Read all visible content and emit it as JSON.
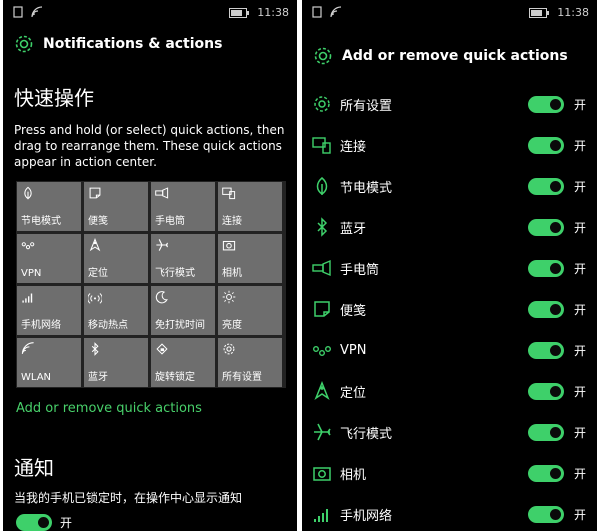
{
  "left_screen": {
    "status": {
      "time": "11:38"
    },
    "title": "Notifications & actions",
    "section_title": "快速操作",
    "description": "Press and hold (or select) quick actions, then drag to rearrange them. These quick actions appear in action center.",
    "tiles": [
      {
        "label": "节电模式",
        "icon": "leaf-icon"
      },
      {
        "label": "便笺",
        "icon": "note-icon"
      },
      {
        "label": "手电筒",
        "icon": "flashlight-icon"
      },
      {
        "label": "连接",
        "icon": "connect-icon"
      },
      {
        "label": "VPN",
        "icon": "vpn-icon"
      },
      {
        "label": "定位",
        "icon": "location-icon"
      },
      {
        "label": "飞行模式",
        "icon": "airplane-icon"
      },
      {
        "label": "相机",
        "icon": "camera-icon"
      },
      {
        "label": "手机网络",
        "icon": "signal-icon"
      },
      {
        "label": "移动热点",
        "icon": "hotspot-icon"
      },
      {
        "label": "免打扰时间",
        "icon": "moon-icon"
      },
      {
        "label": "亮度",
        "icon": "brightness-icon"
      },
      {
        "label": "WLAN",
        "icon": "wifi-icon"
      },
      {
        "label": "蓝牙",
        "icon": "bluetooth-icon"
      },
      {
        "label": "旋转锁定",
        "icon": "rotation-lock-icon"
      },
      {
        "label": "所有设置",
        "icon": "gear-icon"
      }
    ],
    "add_remove_link": "Add or remove quick actions",
    "notify_title": "通知",
    "notify_text": "当我的手机已锁定时，在操作中心显示通知",
    "notify_toggle_state": "开"
  },
  "right_screen": {
    "status": {
      "time": "11:38"
    },
    "title": "Add or remove quick actions",
    "items": [
      {
        "label": "所有设置",
        "icon": "gear-icon",
        "state": "开"
      },
      {
        "label": "连接",
        "icon": "connect-icon",
        "state": "开"
      },
      {
        "label": "节电模式",
        "icon": "leaf-icon",
        "state": "开"
      },
      {
        "label": "蓝牙",
        "icon": "bluetooth-icon",
        "state": "开"
      },
      {
        "label": "手电筒",
        "icon": "flashlight-icon",
        "state": "开"
      },
      {
        "label": "便笺",
        "icon": "note-icon",
        "state": "开"
      },
      {
        "label": "VPN",
        "icon": "vpn-icon",
        "state": "开"
      },
      {
        "label": "定位",
        "icon": "location-icon",
        "state": "开"
      },
      {
        "label": "飞行模式",
        "icon": "airplane-icon",
        "state": "开"
      },
      {
        "label": "相机",
        "icon": "camera-icon",
        "state": "开"
      },
      {
        "label": "手机网络",
        "icon": "signal-icon",
        "state": "开"
      }
    ]
  },
  "colors": {
    "accent": "#3ed06a",
    "tile": "#6e6e6e",
    "background": "#000000"
  }
}
